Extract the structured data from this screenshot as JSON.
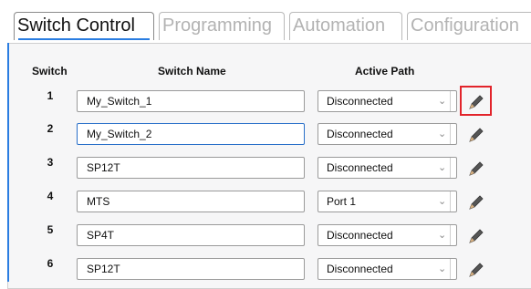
{
  "tabs": [
    {
      "label": "Switch Control"
    },
    {
      "label": "Programming"
    },
    {
      "label": "Automation"
    },
    {
      "label": "Configuration"
    }
  ],
  "table": {
    "headers": {
      "switch": "Switch",
      "name": "Switch Name",
      "path": "Active Path"
    },
    "rows": [
      {
        "num": "1",
        "name": "My_Switch_1",
        "path": "Disconnected"
      },
      {
        "num": "2",
        "name": "My_Switch_2",
        "path": "Disconnected"
      },
      {
        "num": "3",
        "name": "SP12T",
        "path": "Disconnected"
      },
      {
        "num": "4",
        "name": "MTS",
        "path": "Port 1"
      },
      {
        "num": "5",
        "name": "SP4T",
        "path": "Disconnected"
      },
      {
        "num": "6",
        "name": "SP12T",
        "path": "Disconnected"
      }
    ]
  },
  "icons": {
    "edit": "pencil-icon",
    "dropdown": "chevron-down-icon"
  },
  "colors": {
    "accent": "#2a7de1",
    "highlight": "#e2242b",
    "panel_bg": "#f6f6f7"
  }
}
